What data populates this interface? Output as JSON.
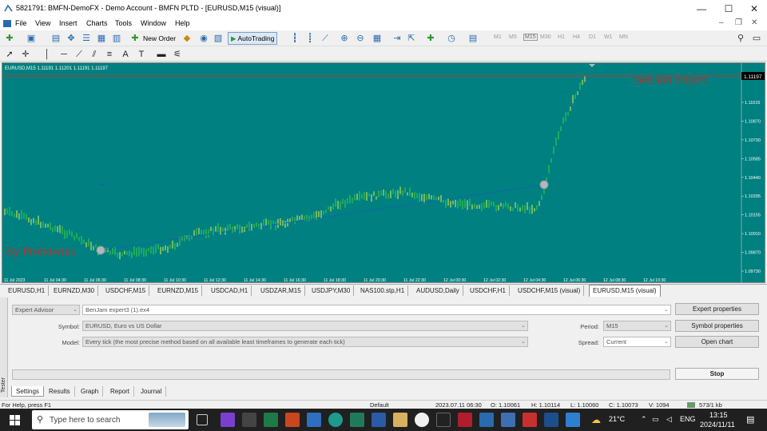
{
  "window": {
    "title": "5821791: BMFN-DemoFX - Demo Account - BMFN PLTD - [EURUSD,M15 (visual)]",
    "controls": [
      "—",
      "☐",
      "✕"
    ]
  },
  "menu": [
    "File",
    "View",
    "Insert",
    "Charts",
    "Tools",
    "Window",
    "Help"
  ],
  "toolbar": {
    "new_order": "New Order",
    "autotrading": "AutoTrading",
    "timeframes": [
      "M1",
      "M5",
      "M15",
      "M30",
      "H1",
      "H4",
      "D1",
      "W1",
      "MN"
    ],
    "active_timeframe": "M15"
  },
  "chart": {
    "header": "EURUSD,M15  1.11191 1.11201 1.11191 1.11197",
    "overlay_top": "BenJam Expert",
    "overlay_bottom": "By Profxtwins",
    "background_color": "#008080",
    "price_badge": "1.11197",
    "y_ticks": [
      "1.11015",
      "1.10870",
      "1.10730",
      "1.10585",
      "1.10440",
      "1.10295",
      "1.10155",
      "1.10010",
      "1.09870",
      "1.09730"
    ],
    "x_ticks": [
      "11 Jul 2023",
      "11 Jul 04:30",
      "11 Jul 06:30",
      "11 Jul 08:30",
      "11 Jul 10:30",
      "11 Jul 12:30",
      "11 Jul 14:30",
      "11 Jul 16:30",
      "11 Jul 18:30",
      "11 Jul 20:30",
      "11 Jul 22:30",
      "12 Jul 00:30",
      "12 Jul 02:30",
      "12 Jul 04:30",
      "12 Jul 06:30",
      "12 Jul 08:30",
      "12 Jul 10:30"
    ]
  },
  "chart_tabs": [
    "EURUSD,H1",
    "EURNZD,M30",
    "USDCHF,M15",
    "EURNZD,M15",
    "USDCAD,H1",
    "USDZAR,M15",
    "USDJPY,M30",
    "NAS100.stp,H1",
    "AUDUSD,Daily",
    "USDCHF,H1",
    "USDCHF,M15 (visual)",
    "EURUSD,M15 (visual)"
  ],
  "active_chart_tab": "EURUSD,M15 (visual)",
  "tester": {
    "side_label": "Tester",
    "mode": "Expert Advisor",
    "expert": "BenJam expert3 (1).ex4",
    "symbol_label": "Symbol:",
    "symbol": "EURUSD, Euro vs US Dollar",
    "model_label": "Model:",
    "model": "Every tick (the most precise method based on all available least timeframes to generate each tick)",
    "period_label": "Period:",
    "period": "M15",
    "spread_label": "Spread:",
    "spread": "Current",
    "buttons": {
      "expert_properties": "Expert properties",
      "symbol_properties": "Symbol properties",
      "open_chart": "Open chart",
      "stop": "Stop"
    },
    "tabs": [
      "Settings",
      "Results",
      "Graph",
      "Report",
      "Journal"
    ],
    "active_tab": "Settings"
  },
  "statusbar": {
    "help": "For Help, press F1",
    "profile": "Default",
    "datetime": "2023.07.11 06:30",
    "open": "O: 1.10061",
    "high": "H: 1.10114",
    "low": "L: 1.10060",
    "close": "C: 1.10073",
    "volume": "V: 1094",
    "traffic": "573/1 kb"
  },
  "taskbar": {
    "search_placeholder": "Type here to search",
    "weather": "21°C",
    "language": "ENG",
    "time": "13:15",
    "date": "2024/11/11"
  }
}
